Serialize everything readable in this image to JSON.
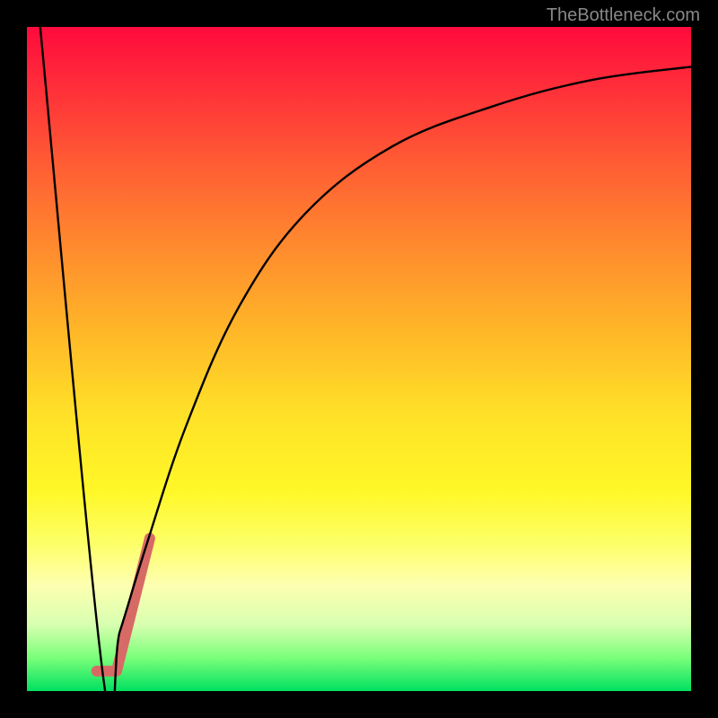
{
  "watermark": {
    "text": "TheBottleneck.com"
  },
  "chart_data": {
    "type": "line",
    "title": "",
    "xlabel": "",
    "ylabel": "",
    "xlim": [
      0,
      100
    ],
    "ylim": [
      0,
      100
    ],
    "grid": false,
    "legend": false,
    "gradient": {
      "direction": "vertical",
      "stops": [
        {
          "pos": 0,
          "color": "#ff0a3c"
        },
        {
          "pos": 20,
          "color": "#ff5a34"
        },
        {
          "pos": 46,
          "color": "#ffb728"
        },
        {
          "pos": 70,
          "color": "#fff828"
        },
        {
          "pos": 90,
          "color": "#d8ffb0"
        },
        {
          "pos": 100,
          "color": "#00e060"
        }
      ]
    },
    "series": [
      {
        "name": "bottleneck-curve",
        "color": "#000000",
        "width": 2,
        "points": [
          {
            "x": 2,
            "y": 100
          },
          {
            "x": 11.5,
            "y": 2
          },
          {
            "x": 14,
            "y": 9
          },
          {
            "x": 18,
            "y": 22
          },
          {
            "x": 24,
            "y": 40
          },
          {
            "x": 32,
            "y": 58
          },
          {
            "x": 42,
            "y": 72
          },
          {
            "x": 55,
            "y": 82
          },
          {
            "x": 70,
            "y": 88
          },
          {
            "x": 85,
            "y": 92
          },
          {
            "x": 100,
            "y": 94
          }
        ]
      },
      {
        "name": "highlight-segment",
        "color": "#d86a66",
        "width": 10,
        "points": [
          {
            "x": 10.5,
            "y": 3
          },
          {
            "x": 13.5,
            "y": 3
          },
          {
            "x": 16,
            "y": 13
          },
          {
            "x": 18.5,
            "y": 23
          }
        ]
      }
    ]
  }
}
